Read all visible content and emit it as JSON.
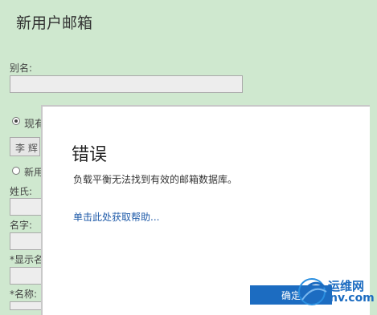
{
  "page": {
    "title": "新用户邮箱"
  },
  "form": {
    "alias_label": "别名:",
    "existing_option": "现有",
    "existing_value": "李 辉",
    "new_option": "新用",
    "lastname_label": "姓氏:",
    "firstname_label": "名字:",
    "displayname_label": "*显示名",
    "name_label": "*名称:"
  },
  "dialog": {
    "title": "错误",
    "message": "负载平衡无法找到有效的邮箱数据库。",
    "help_link": "单击此处获取帮助...",
    "ok_label": "确定"
  },
  "watermark": {
    "text": "运维网",
    "subtext": "nv.com"
  }
}
